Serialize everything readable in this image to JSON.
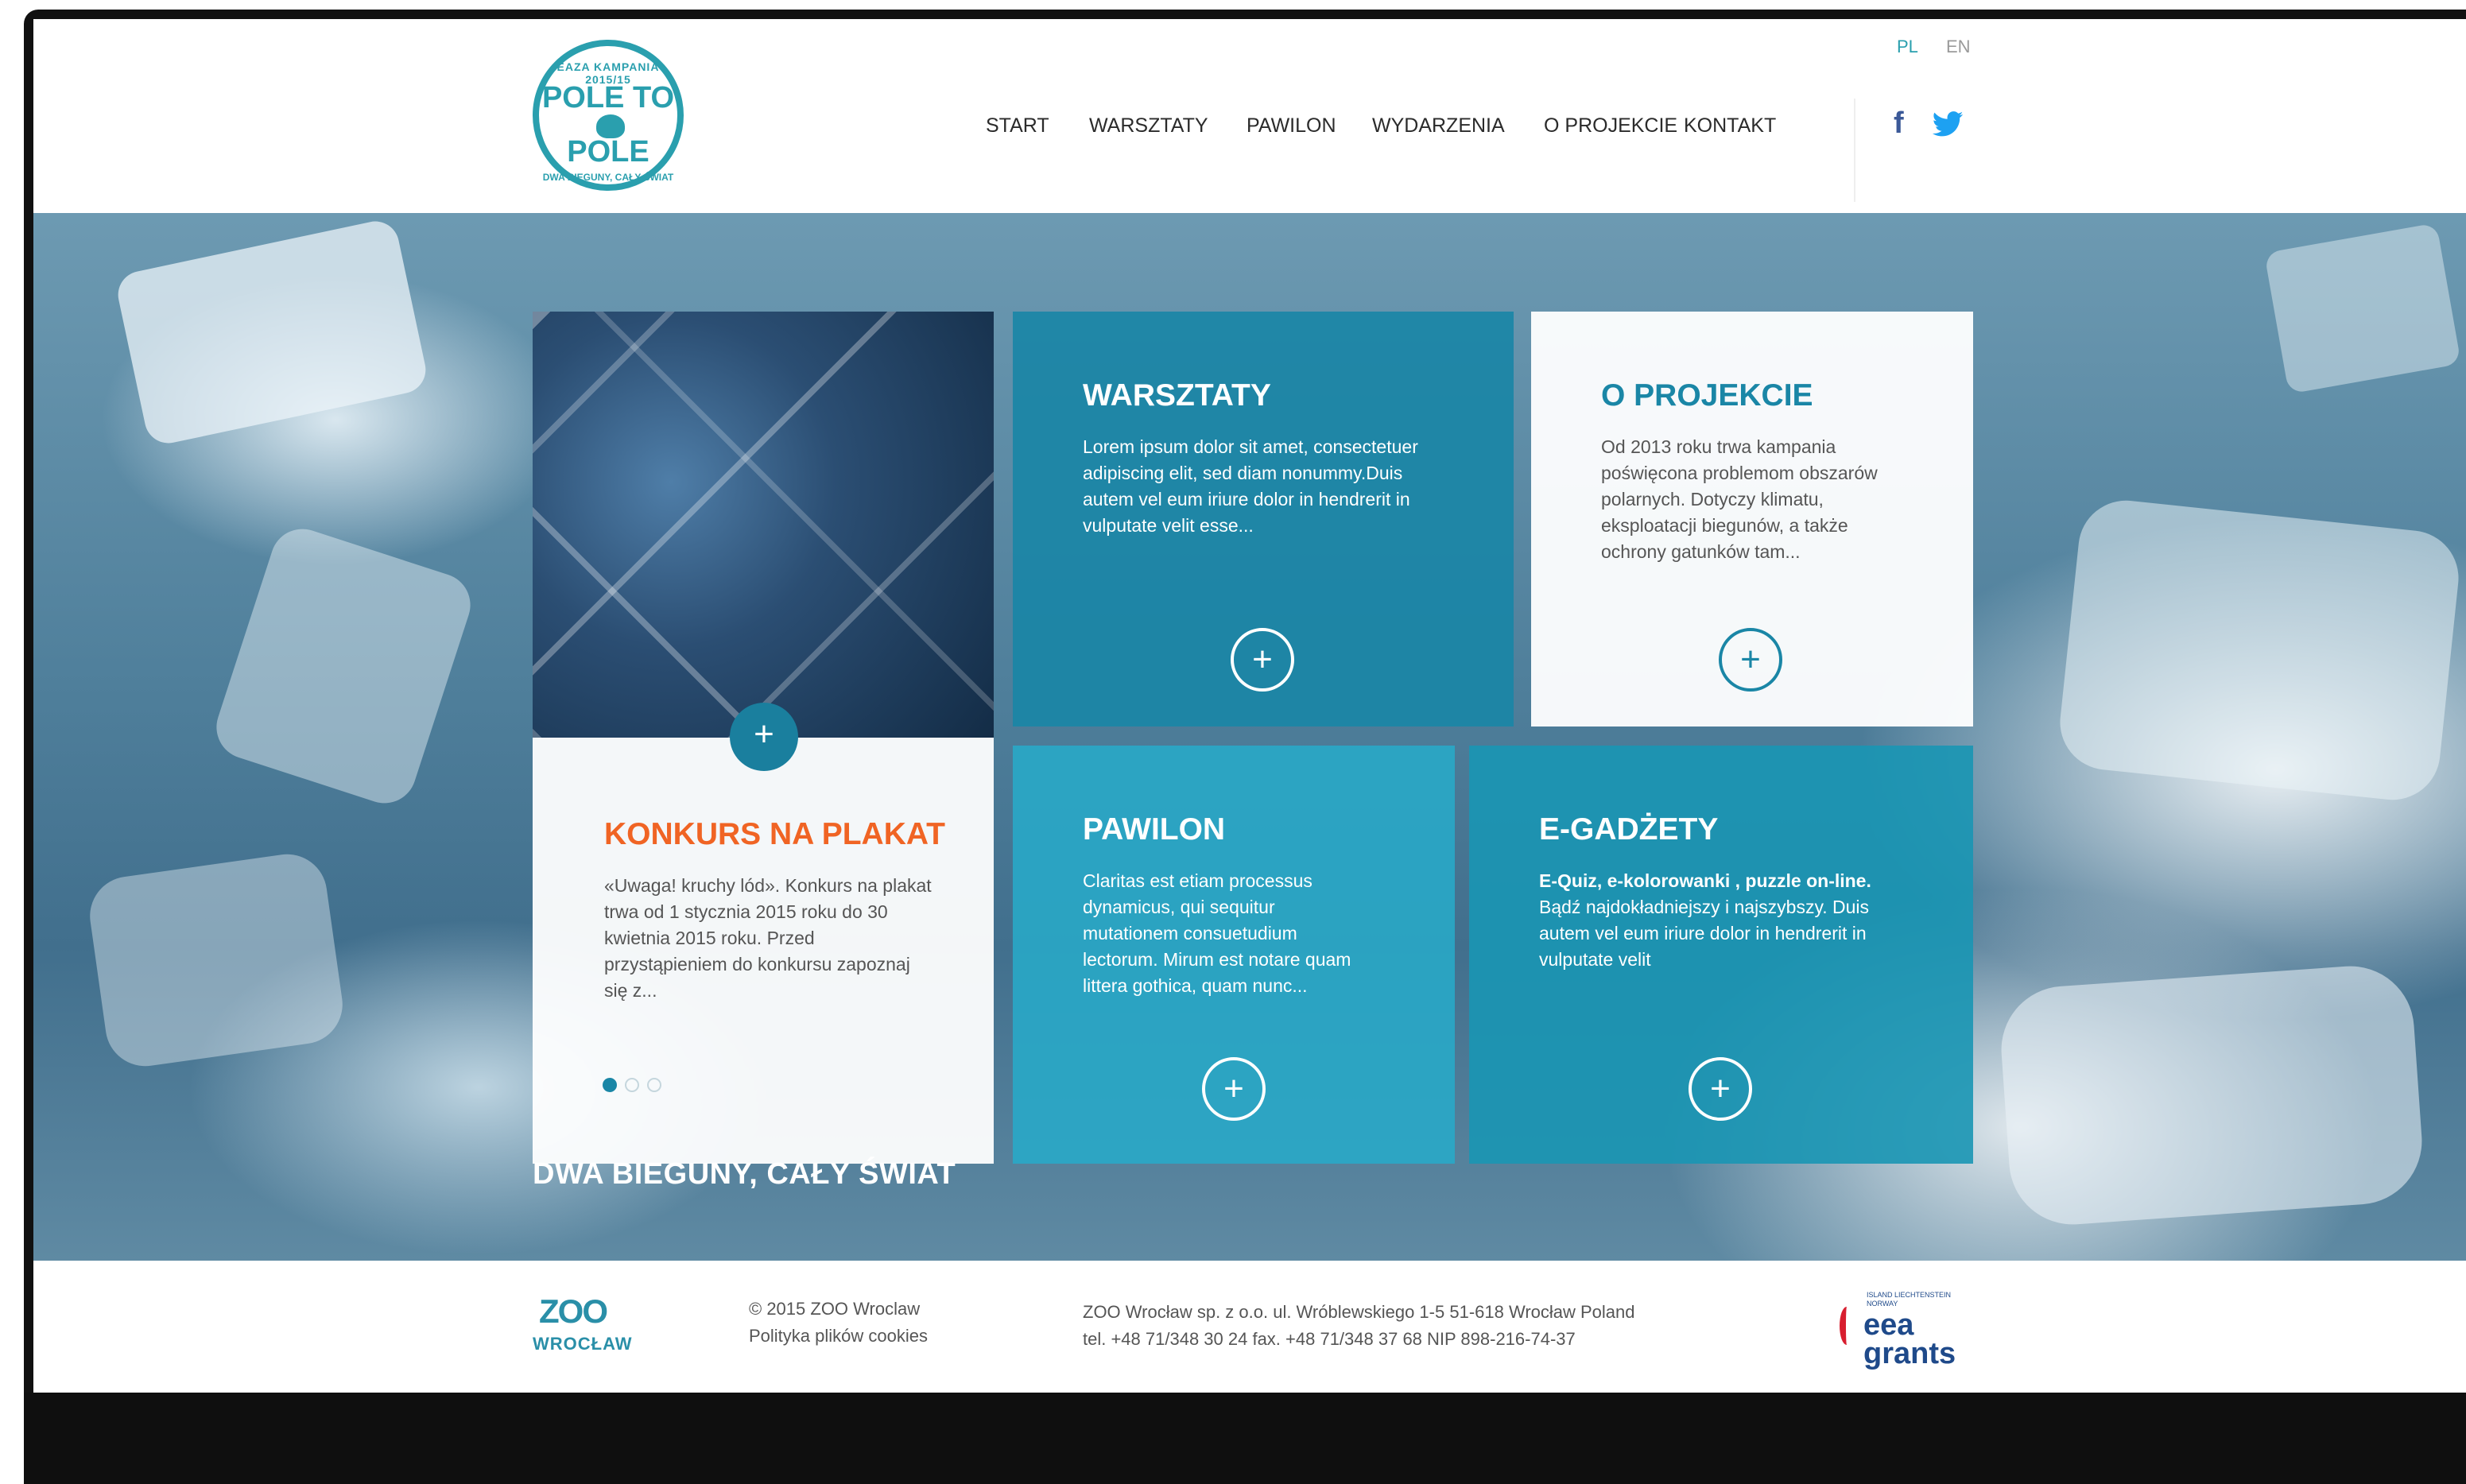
{
  "header": {
    "logo": {
      "ring_top": "EAZA KAMPANIA 2015/15",
      "line1": "POLE TO",
      "line2": "POLE",
      "ring_bottom": "DWA BIEGUNY, CAŁY ŚWIAT"
    },
    "nav": [
      "START",
      "WARSZTATY",
      "PAWILON",
      "WYDARZENIA",
      "O PROJEKCIE",
      "KONTAKT"
    ],
    "lang": {
      "pl": "PL",
      "en": "EN"
    },
    "social": {
      "facebook": "f"
    }
  },
  "hero": {
    "tagline": "DWA BIEGUNY, CAŁY ŚWIAT",
    "tiles": {
      "konkurs": {
        "title": "KONKURS NA PLAKAT",
        "text": "«Uwaga! kruchy lód». Konkurs na plakat trwa od 1 stycznia 2015 roku do 30 kwietnia 2015 roku. Przed przystąpieniem do konkursu zapoznaj się z..."
      },
      "warsztaty": {
        "title": "WARSZTATY",
        "text": "Lorem ipsum dolor sit amet, consectetuer adipiscing elit, sed diam nonummy.Duis autem vel eum iriure dolor in hendrerit in vulputate velit esse..."
      },
      "oprojekcie": {
        "title": "O PROJEKCIE",
        "text": "Od 2013 roku trwa kampania poświęcona problemom obszarów polarnych. Dotyczy klimatu, eksploatacji biegunów, a także ochrony gatunków tam..."
      },
      "pawilon": {
        "title": "PAWILON",
        "text": "Claritas est etiam processus dynamicus, qui sequitur mutationem consuetudium lectorum. Mirum est notare quam littera gothica, quam nunc..."
      },
      "egadzety": {
        "title": "E-GADŻETY",
        "text_bold": "E-Quiz, e-kolorowanki , puzzle on-line.",
        "text": " Bądź najdokładniejszy i najszybszy. Duis autem vel eum iriure dolor in hendrerit in vulputate velit"
      }
    },
    "plus": "+"
  },
  "footer": {
    "zoo_logo_name": "WROCŁAW",
    "zoo_logo_mark": "ZOO",
    "copyright": "© 2015  ZOO Wroclaw",
    "cookies": "Polityka plików cookies",
    "address": "ZOO Wrocław sp. z o.o. ul. Wróblewskiego 1-5 51-618 Wrocław Poland",
    "phone": "tel. +48 71/348 30 24  fax. +48 71/348 37 68  NIP 898-216-74-37",
    "eea_small": "ISLAND LIECHTENSTEIN NORWAY",
    "eea_1": "eea",
    "eea_2": "grants"
  },
  "colors": {
    "accent_teal": "#1a86a6",
    "accent_orange": "#f06424",
    "facebook_blue": "#3b5998",
    "twitter_blue": "#1da1f2"
  }
}
